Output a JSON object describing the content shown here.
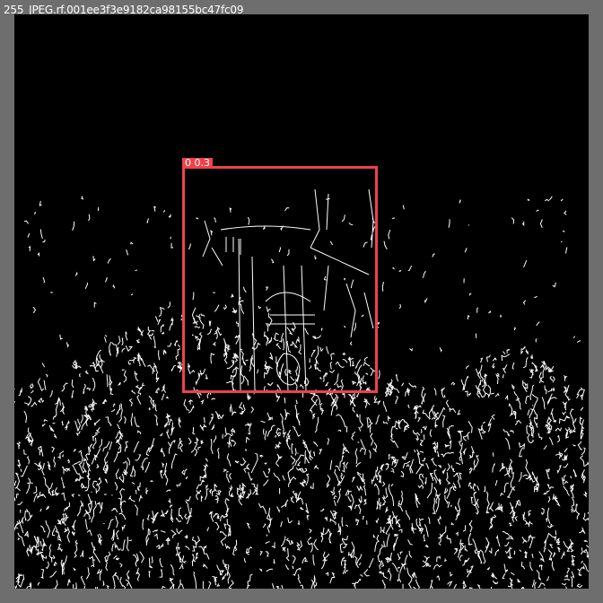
{
  "window": {
    "title": "255_JPEG.rf.001ee3f3e9182ca98155bc47fc09"
  },
  "image": {
    "description_icon": "edge-map-image",
    "background": "#000000",
    "edge_color": "#ffffff"
  },
  "detection": {
    "label": "0 0.3",
    "class_id": "0",
    "confidence": "0.3",
    "color": "#f0414a"
  },
  "colors": {
    "frame": "#6e6e6e",
    "box": "#f0414a"
  }
}
